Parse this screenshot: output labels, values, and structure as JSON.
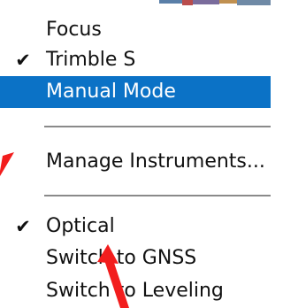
{
  "menu": {
    "items": [
      {
        "label": "Focus",
        "checked": false,
        "selected": false
      },
      {
        "label": "Trimble S",
        "checked": true,
        "selected": false
      },
      {
        "label": "Manual Mode",
        "checked": false,
        "selected": true
      },
      {
        "label": "Manage Instruments...",
        "checked": false,
        "selected": false
      },
      {
        "label": "Optical",
        "checked": true,
        "selected": false
      },
      {
        "label": "Switch to GNSS",
        "checked": false,
        "selected": false
      },
      {
        "label": "Switch to Leveling",
        "checked": false,
        "selected": false
      }
    ],
    "check_glyph": "✔",
    "selected_color": "#0b72c6"
  },
  "annotation": {
    "arrow_color": "#f21d1d"
  }
}
